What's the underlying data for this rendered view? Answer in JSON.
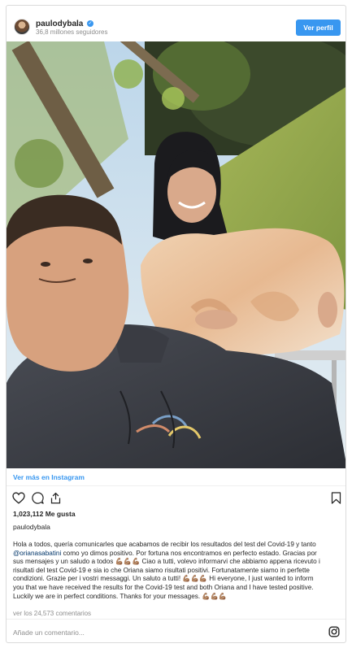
{
  "header": {
    "username": "paulodybala",
    "followers": "36,8 millones seguidores",
    "follow_button": "Ver perfil"
  },
  "post": {
    "view_more_link": "Ver más en Instagram",
    "likes": "1,023,112 Me gusta",
    "caption_username": "paulodybala",
    "caption": {
      "line1": "Hola a todos, quería comunicarles que acabamos de recibir los resultados del test del Covid-19 y tanto",
      "mention": "@orianasabatini",
      "line2_rest": " como yo dimos positivo. Por fortuna nos encontramos en perfecto estado. Gracias por",
      "line3": "sus mensajes y un saludo a todos 💪🏽💪🏽💪🏽 Ciao a tutti, volevo informarvi che abbiamo appena ricevuto i",
      "line4": "risultati del test Covid-19 e sia io che Oriana siamo risultati positivi. Fortunatamente siamo in perfette",
      "line5": "condizioni. Grazie per i vostri messaggi. Un saluto a tutti! 💪🏽💪🏽💪🏽 Hi everyone, I just wanted to inform",
      "line6": "you that we have received the results for the Covid-19 test and both Oriana and I have tested positive.",
      "line7": "Luckily we are in perfect conditions. Thanks for your messages. 💪🏽💪🏽💪🏽"
    },
    "comments_link": "ver los 24,573 comentarios",
    "comment_placeholder": "Añade un comentario..."
  },
  "icons": {
    "verified": "verified-badge-icon",
    "like": "heart-icon",
    "comment": "comment-icon",
    "share": "share-icon",
    "save": "bookmark-icon",
    "instagram": "instagram-logo-icon"
  },
  "colors": {
    "accent": "#3897f0",
    "mention": "#003569",
    "muted": "#8e8e8e"
  }
}
